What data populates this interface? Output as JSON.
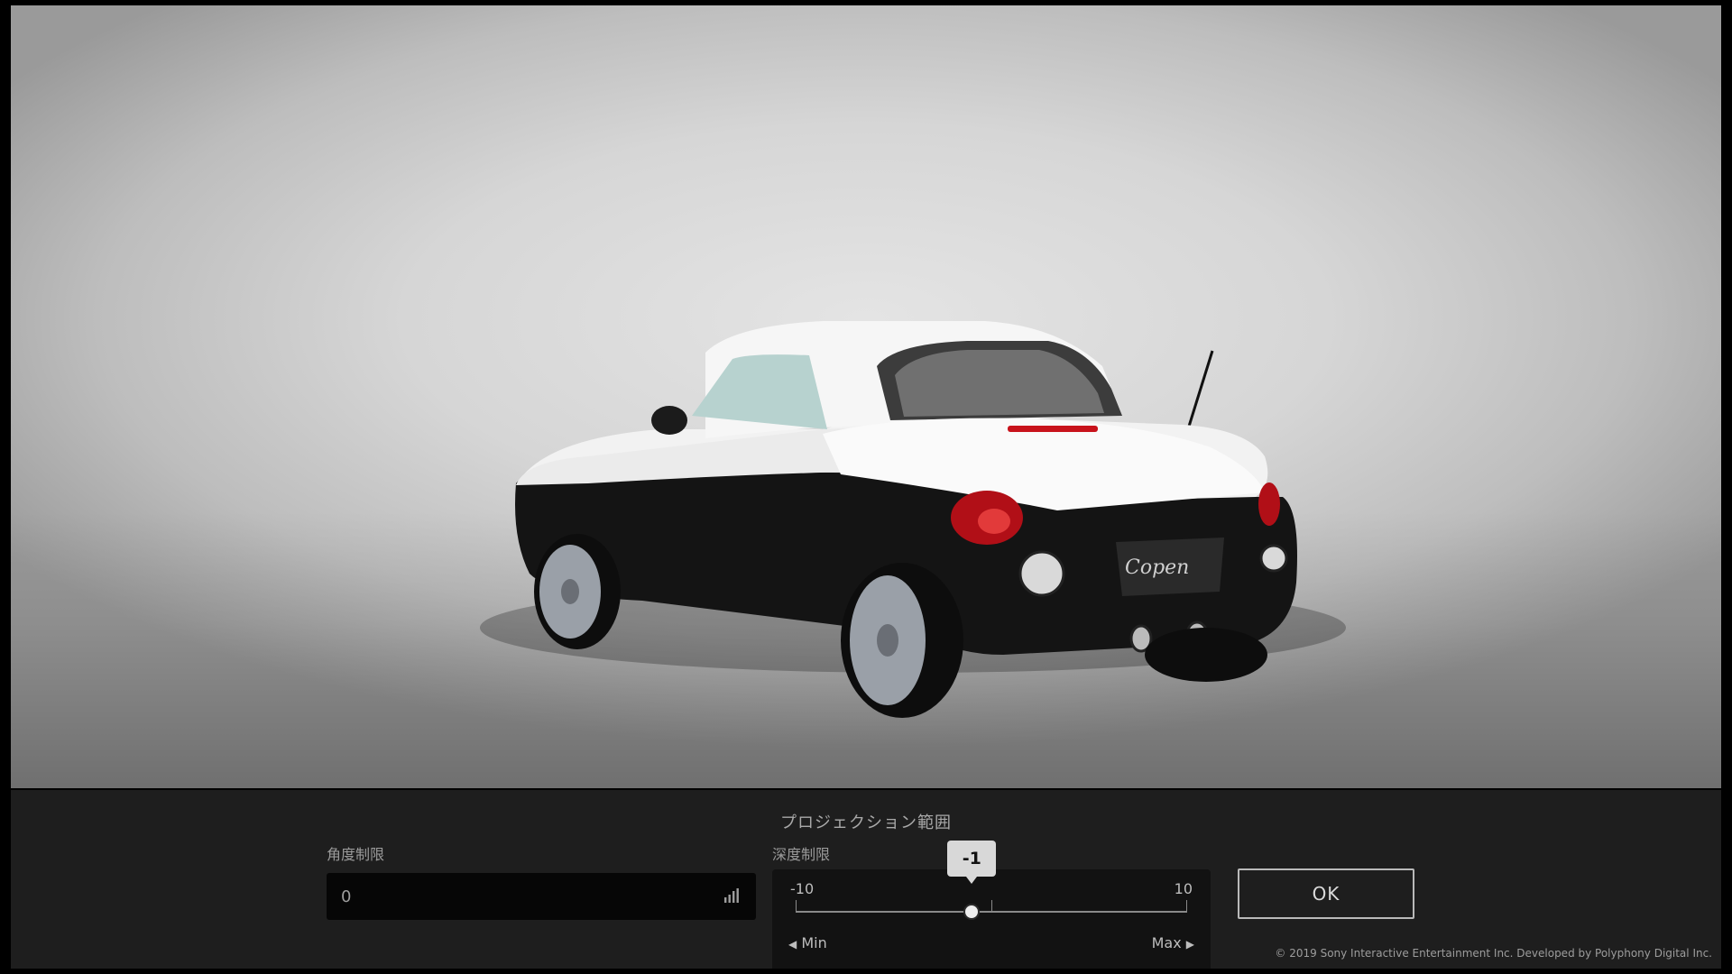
{
  "panel": {
    "title": "プロジェクション範囲"
  },
  "angle_limit": {
    "label": "角度制限",
    "value": "0",
    "icon": "signal-bars-icon"
  },
  "depth_limit": {
    "label": "深度制限",
    "min_value": "-10",
    "max_value": "10",
    "current_value": "-1",
    "current_number": -1,
    "range": [
      -10,
      10
    ],
    "min_button": "Min",
    "max_button": "Max"
  },
  "ok_button": {
    "label": "OK"
  },
  "footer": {
    "copyright": "© 2019 Sony Interactive Entertainment Inc. Developed by Polyphony Digital Inc."
  },
  "car": {
    "badge_text": "Copen"
  },
  "colors": {
    "panel_bg": "#1e1e1e",
    "field_bg": "#060606",
    "tooltip_bg": "#d8d8d8",
    "ok_border": "#b9b9b9"
  }
}
